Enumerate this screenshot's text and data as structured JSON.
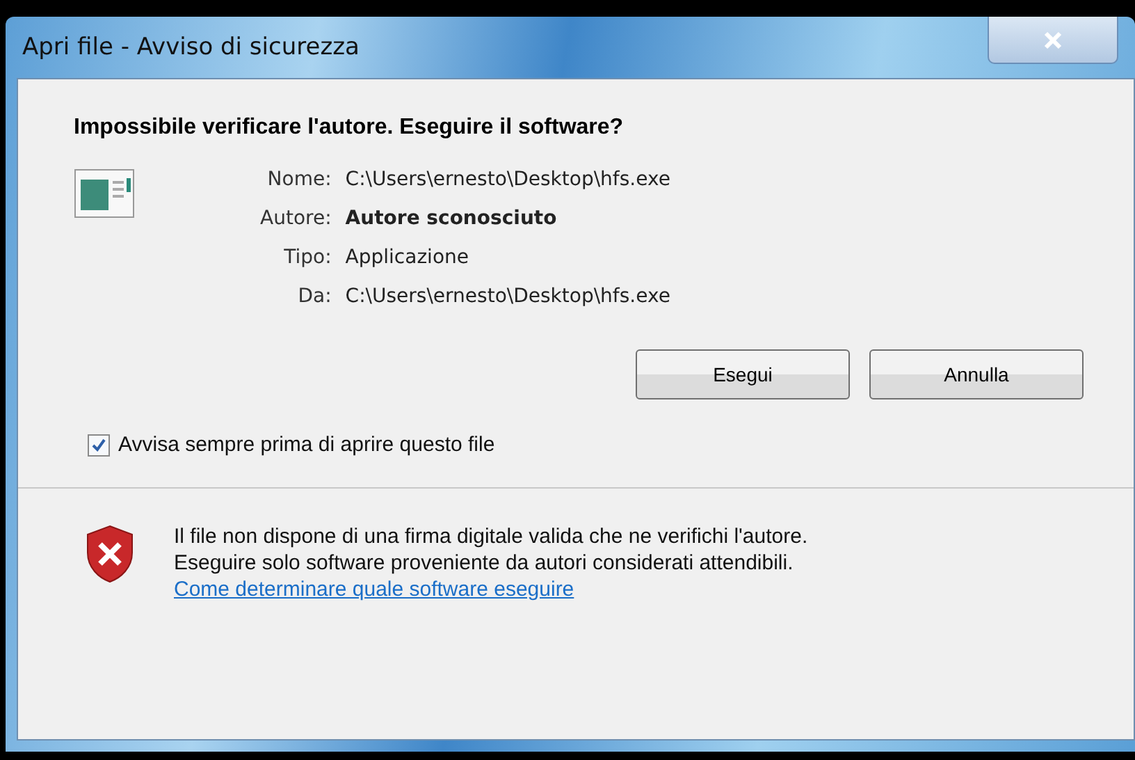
{
  "window": {
    "title": "Apri file - Avviso di sicurezza"
  },
  "heading": "Impossibile verificare l'autore. Eseguire il software?",
  "details": [
    {
      "label": "Nome:",
      "value": "C:\\Users\\ernesto\\Desktop\\hfs.exe",
      "bold": false
    },
    {
      "label": "Autore:",
      "value": "Autore sconosciuto",
      "bold": true
    },
    {
      "label": "Tipo:",
      "value": "Applicazione",
      "bold": false
    },
    {
      "label": "Da:",
      "value": "C:\\Users\\ernesto\\Desktop\\hfs.exe",
      "bold": false
    }
  ],
  "buttons": [
    "Esegui",
    "Annulla"
  ],
  "always_warn": {
    "label": "Avvisa sempre prima di aprire questo file",
    "checked": true
  },
  "footer": {
    "lines": [
      "Il file non dispone di una firma digitale valida che ne verifichi l'autore.",
      "Eseguire solo software proveniente da autori considerati attendibili."
    ],
    "link": "Come determinare quale software eseguire"
  }
}
